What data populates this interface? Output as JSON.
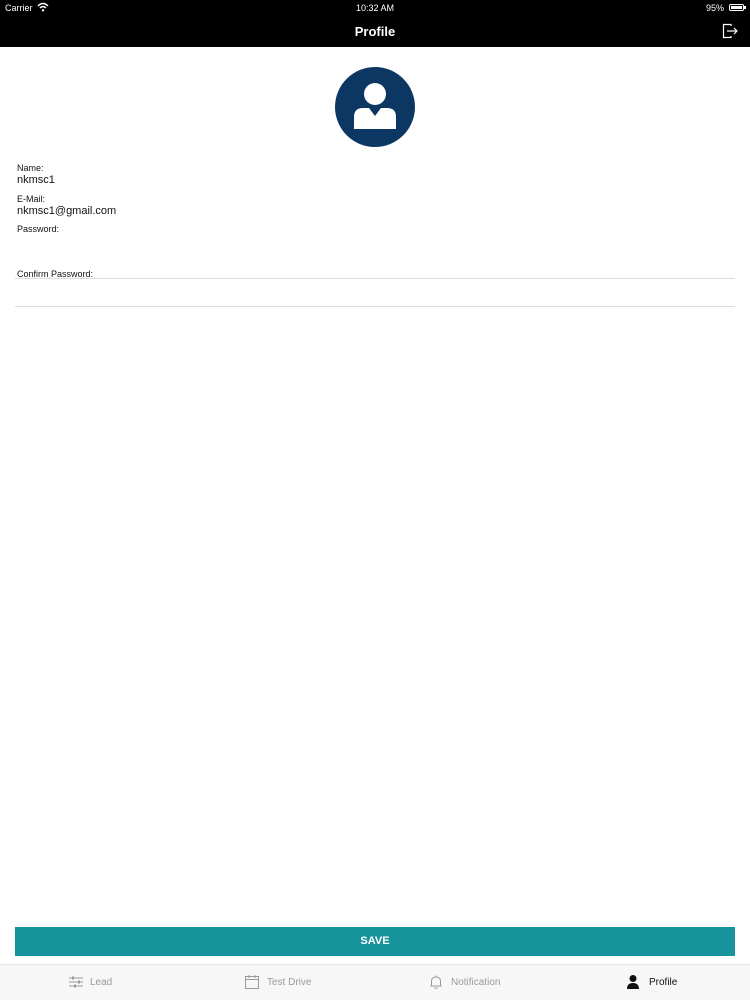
{
  "status_bar": {
    "carrier": "Carrier",
    "time": "10:32 AM",
    "battery": "95%"
  },
  "nav": {
    "title": "Profile",
    "logout_icon": "logout-icon"
  },
  "avatar_icon": "user-avatar-icon",
  "profile": {
    "name_label": "Name:",
    "name_value": "nkmsc1",
    "email_label": "E-Mail:",
    "email_value": "nkmsc1@gmail.com",
    "password_label": "Password:",
    "password_value": "",
    "confirm_password_label": "Confirm Password:",
    "confirm_password_value": ""
  },
  "save_button": "SAVE",
  "tabs": [
    {
      "label": "Lead",
      "icon": "sliders-icon",
      "active": false
    },
    {
      "label": "Test Drive",
      "icon": "calendar-icon",
      "active": false
    },
    {
      "label": "Notification",
      "icon": "bell-icon",
      "active": false
    },
    {
      "label": "Profile",
      "icon": "person-icon",
      "active": true
    }
  ],
  "colors": {
    "accent": "#17939b",
    "avatar_bg": "#0c3762",
    "header_bg": "#000000"
  }
}
